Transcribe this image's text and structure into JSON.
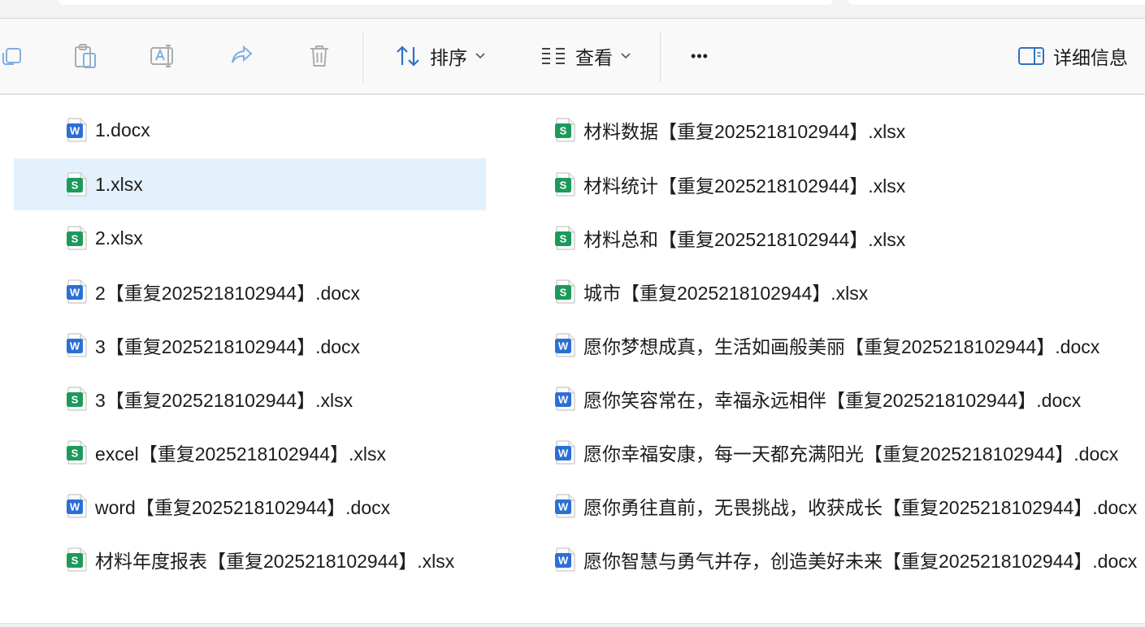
{
  "toolbar": {
    "sort_label": "排序",
    "view_label": "查看",
    "more_label": "•••",
    "details_label": "详细信息"
  },
  "colors": {
    "word": "#2b6fd6",
    "excel": "#1d9a5b",
    "selection": "#e3f1fc",
    "icon_gray": "#9aa0a6",
    "accent": "#1a73c8"
  },
  "files_left": [
    {
      "name": "1.docx",
      "type": "word"
    },
    {
      "name": "1.xlsx",
      "type": "excel",
      "selected": true
    },
    {
      "name": "2.xlsx",
      "type": "excel"
    },
    {
      "name": "2【重复2025218102944】.docx",
      "type": "word"
    },
    {
      "name": "3【重复2025218102944】.docx",
      "type": "word"
    },
    {
      "name": "3【重复2025218102944】.xlsx",
      "type": "excel"
    },
    {
      "name": "excel【重复2025218102944】.xlsx",
      "type": "excel"
    },
    {
      "name": "word【重复2025218102944】.docx",
      "type": "word"
    },
    {
      "name": "材料年度报表【重复2025218102944】.xlsx",
      "type": "excel"
    }
  ],
  "files_right": [
    {
      "name": "材料数据【重复2025218102944】.xlsx",
      "type": "excel"
    },
    {
      "name": "材料统计【重复2025218102944】.xlsx",
      "type": "excel"
    },
    {
      "name": "材料总和【重复2025218102944】.xlsx",
      "type": "excel"
    },
    {
      "name": "城市【重复2025218102944】.xlsx",
      "type": "excel"
    },
    {
      "name": "愿你梦想成真，生活如画般美丽【重复2025218102944】.docx",
      "type": "word"
    },
    {
      "name": "愿你笑容常在，幸福永远相伴【重复2025218102944】.docx",
      "type": "word"
    },
    {
      "name": "愿你幸福安康，每一天都充满阳光【重复2025218102944】.docx",
      "type": "word"
    },
    {
      "name": "愿你勇往直前，无畏挑战，收获成长【重复2025218102944】.docx",
      "type": "word"
    },
    {
      "name": "愿你智慧与勇气并存，创造美好未来【重复2025218102944】.docx",
      "type": "word"
    }
  ]
}
